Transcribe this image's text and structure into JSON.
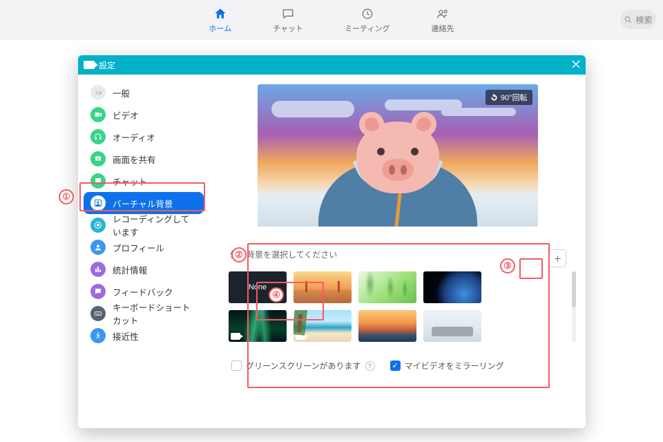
{
  "topnav": {
    "items": [
      {
        "label": "ホーム",
        "selected": true
      },
      {
        "label": "チャット"
      },
      {
        "label": "ミーティング"
      },
      {
        "label": "連絡先"
      }
    ],
    "search_label": "検索"
  },
  "modal": {
    "title": "設定"
  },
  "sidebar": {
    "items": [
      {
        "label": "一般"
      },
      {
        "label": "ビデオ"
      },
      {
        "label": "オーディオ"
      },
      {
        "label": "画面を共有"
      },
      {
        "label": "チャット"
      },
      {
        "label": "バーチャル背景",
        "active": true
      },
      {
        "label": "レコーディングしています"
      },
      {
        "label": "プロフィール"
      },
      {
        "label": "統計情報"
      },
      {
        "label": "フィードバック"
      },
      {
        "label": "キーボードショートカット"
      },
      {
        "label": "接近性"
      }
    ]
  },
  "preview": {
    "rotate_label": "90°回転"
  },
  "picker": {
    "heading": "仮想背景を選択してください",
    "none_label": "None"
  },
  "options": {
    "green_screen_label": "グリーンスクリーンがあります",
    "mirror_label": "マイビデオをミラーリング",
    "green_screen_checked": false,
    "mirror_checked": true
  },
  "annotations": {
    "n1": "①",
    "n2": "②",
    "n3": "③",
    "n4": "④"
  }
}
